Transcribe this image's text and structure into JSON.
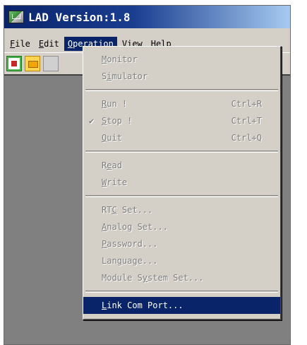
{
  "window": {
    "title": "LAD Version:1.8"
  },
  "menubar": {
    "items": [
      {
        "label": "File",
        "mnemonic": "F",
        "rest": "ile"
      },
      {
        "label": "Edit",
        "mnemonic": "E",
        "rest": "dit"
      },
      {
        "label": "Operation",
        "mnemonic": "O",
        "rest": "peration"
      },
      {
        "label": "View",
        "mnemonic": "V",
        "rest": "iew"
      },
      {
        "label": "Help",
        "mnemonic": "H",
        "rest": "elp"
      }
    ]
  },
  "dropdown": {
    "monitor": {
      "pre": "",
      "mn": "M",
      "post": "onitor"
    },
    "simulator": {
      "pre": "S",
      "mn": "i",
      "post": "mulator"
    },
    "run": {
      "pre": "",
      "mn": "R",
      "post": "un !",
      "shortcut": "Ctrl+R"
    },
    "stop": {
      "pre": "",
      "mn": "S",
      "post": "top !",
      "shortcut": "Ctrl+T",
      "check": "✔"
    },
    "quit": {
      "pre": "",
      "mn": "Q",
      "post": "uit",
      "shortcut": "Ctrl+Q"
    },
    "read": {
      "pre": "R",
      "mn": "e",
      "post": "ad"
    },
    "write": {
      "pre": "",
      "mn": "W",
      "post": "rite"
    },
    "rtc": {
      "pre": "RT",
      "mn": "C",
      "post": " Set..."
    },
    "analog": {
      "pre": "",
      "mn": "A",
      "post": "nalog Set..."
    },
    "password": {
      "pre": "",
      "mn": "P",
      "post": "assword..."
    },
    "language": {
      "pre": "Lan",
      "mn": "g",
      "post": "uage..."
    },
    "module": {
      "pre": "Module S",
      "mn": "y",
      "post": "stem Set..."
    },
    "link": {
      "pre": "",
      "mn": "L",
      "post": "ink Com Port..."
    }
  }
}
